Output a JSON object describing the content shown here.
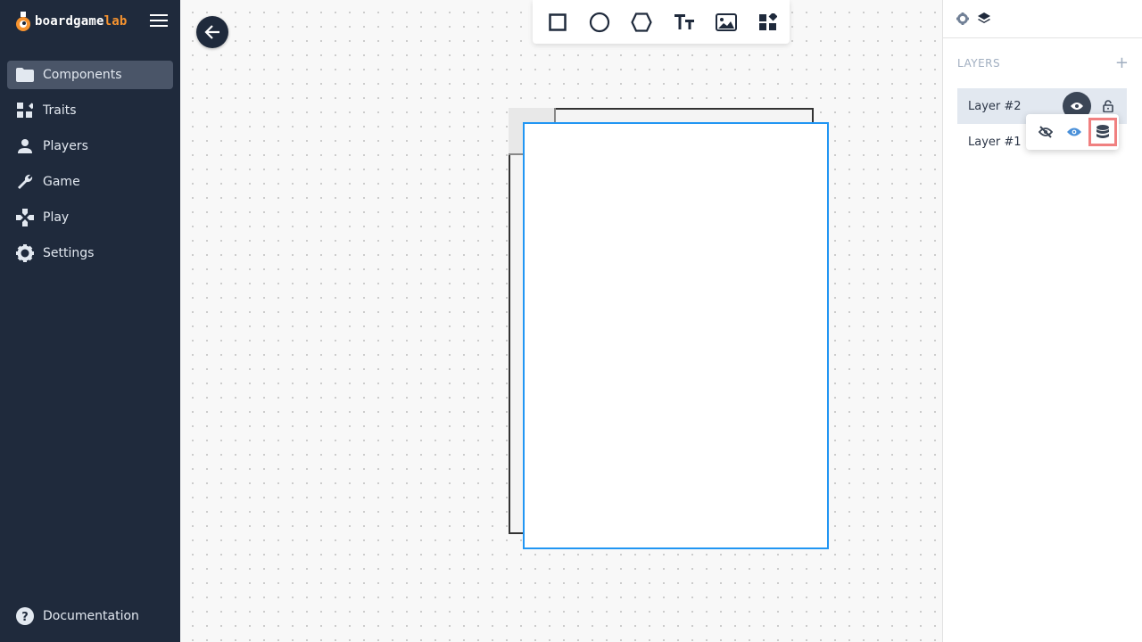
{
  "app": {
    "brand_main": "boardgame",
    "brand_accent": "lab",
    "brand_accent_color": "#f6932f"
  },
  "sidebar": {
    "items": [
      {
        "label": "Components",
        "icon": "folder-icon",
        "active": true
      },
      {
        "label": "Traits",
        "icon": "widgets-icon",
        "active": false
      },
      {
        "label": "Players",
        "icon": "person-icon",
        "active": false
      },
      {
        "label": "Game",
        "icon": "wrench-icon",
        "active": false
      },
      {
        "label": "Play",
        "icon": "gamepad-icon",
        "active": false
      },
      {
        "label": "Settings",
        "icon": "gear-icon",
        "active": false
      }
    ],
    "documentation": "Documentation"
  },
  "toolbar": {
    "tools": [
      "rectangle-tool",
      "circle-tool",
      "hexagon-tool",
      "text-tool",
      "image-tool",
      "component-tool"
    ]
  },
  "panel": {
    "layers_title": "LAYERS",
    "add_symbol": "+",
    "layers": [
      {
        "label": "Layer #2",
        "selected": true
      },
      {
        "label": "Layer #1",
        "selected": false
      }
    ],
    "visibility_options": [
      "hidden",
      "visible",
      "data-bound"
    ]
  },
  "colors": {
    "sidebar_bg": "#1f2a3c",
    "selection": "#2196f3",
    "highlight": "#f08080"
  }
}
